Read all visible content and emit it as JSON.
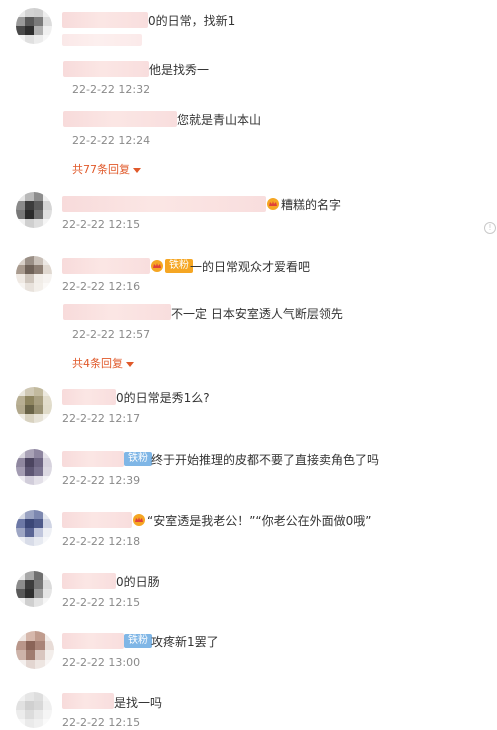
{
  "comments": [
    {
      "text": "0的日常，找新1",
      "time": "22-2-22 12:32",
      "replies": [
        {
          "text": "他是找秀一",
          "time": "22-2-22 12:32"
        },
        {
          "text": "您就是青山本山",
          "time": "22-2-22 12:24"
        }
      ],
      "more": "共77条回复"
    },
    {
      "text": "糟糕的名字",
      "time": "22-2-22 12:15",
      "badge": "crown"
    },
    {
      "text": "一的日常观众才爱看吧",
      "time": "22-2-22 12:16",
      "badge": "crown-fan",
      "fan_label": "铁粉",
      "replies": [
        {
          "text": "不一定 日本安室透人气断层领先",
          "time": "22-2-22 12:57"
        }
      ],
      "more": "共4条回复"
    },
    {
      "text": "0的日常是秀1么?",
      "time": "22-2-22 12:17"
    },
    {
      "text": "终于开始推理的皮都不要了直接卖角色了吗",
      "time": "22-2-22 12:39",
      "badge": "fan",
      "fan_label": "铁粉"
    },
    {
      "text": "“安室透是我老公！”“你老公在外面做0哦”",
      "time": "22-2-22 12:18",
      "badge": "crown"
    },
    {
      "text": "0的日肠",
      "time": "22-2-22 12:15"
    },
    {
      "text": "攻疼新1罢了",
      "time": "22-2-22 13:00",
      "badge": "fan",
      "fan_label": "铁粉"
    },
    {
      "text": "是找一吗",
      "time": "22-2-22 12:15"
    }
  ],
  "colors": {
    "link": "#e0592a",
    "fan_badge": "#7fb6e6",
    "fan_badge_orange": "#f5a623",
    "time": "#8a8a8a",
    "blur": "#f7d9d9"
  },
  "icons": {
    "crown": "crown-icon",
    "caret": "caret-down-icon",
    "side": "info-icon"
  }
}
